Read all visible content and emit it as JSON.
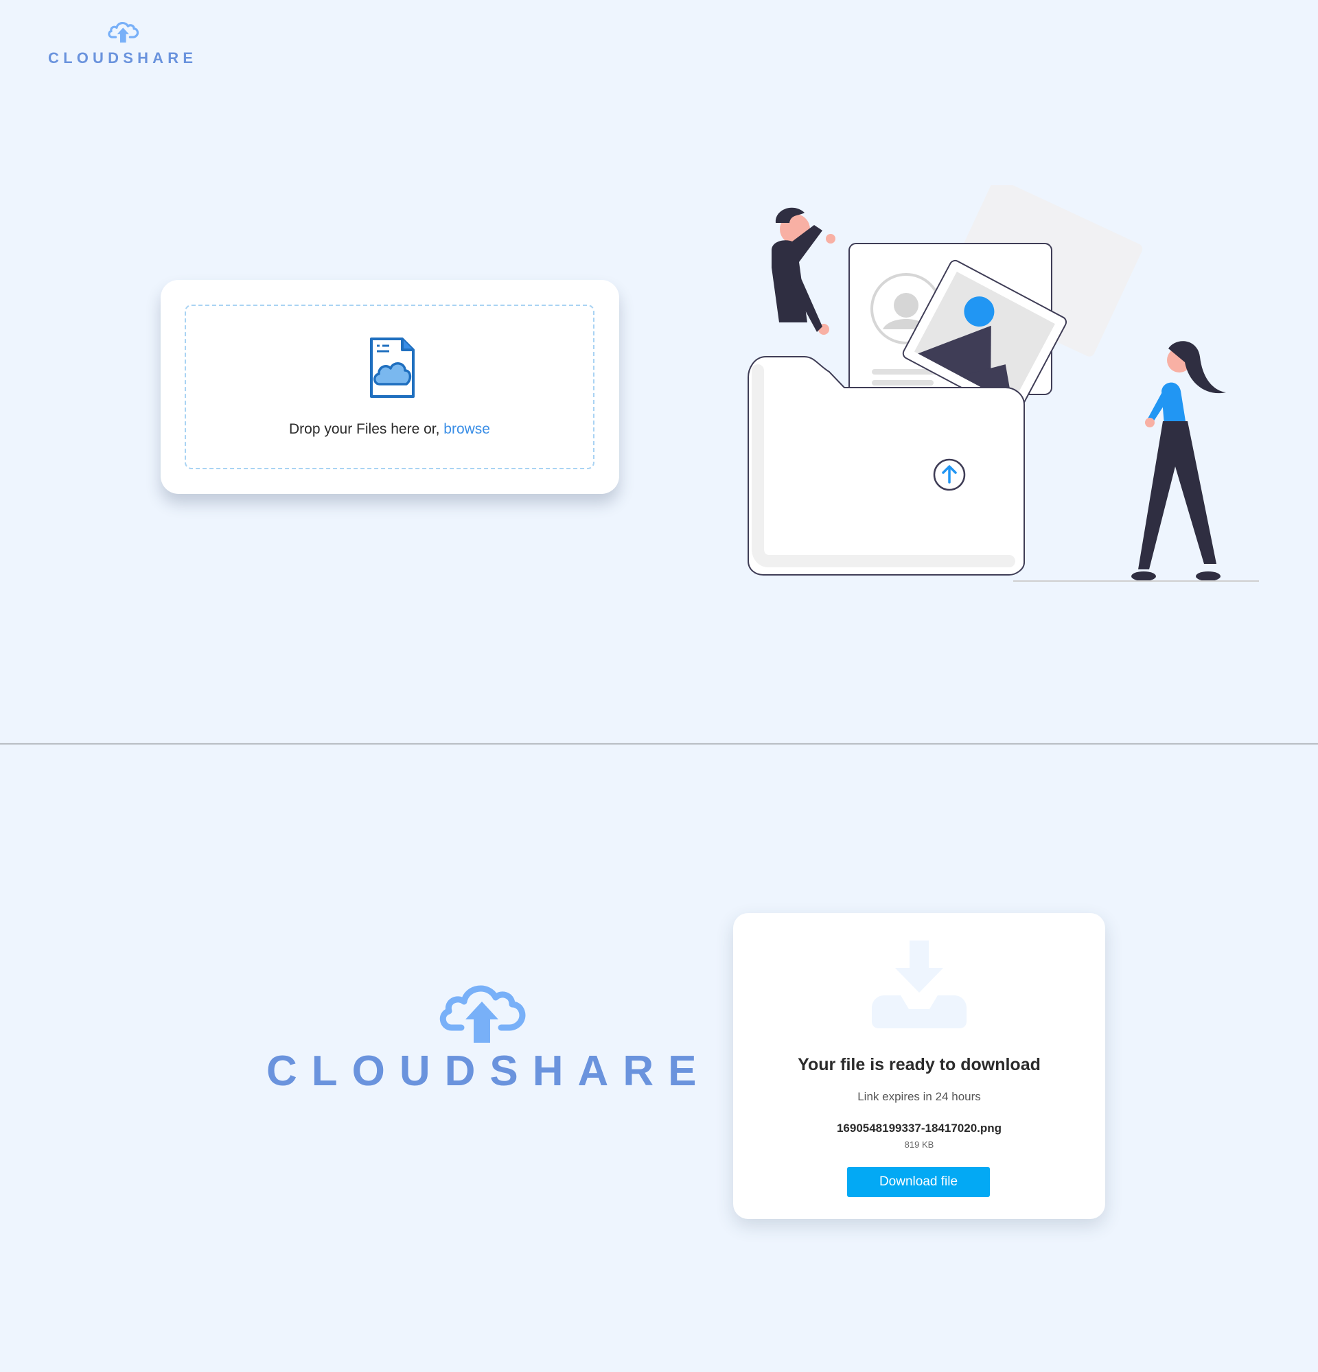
{
  "brand": {
    "name": "CLOUDSHARE",
    "logo_color": "#6a93dd",
    "cloud_color": "#78b0f8"
  },
  "upload": {
    "drop_text": "Drop your Files here or, ",
    "browse_label": "browse",
    "icon": "file-cloud-icon",
    "accent": "#3a8ee6"
  },
  "illustration": {
    "name": "people-uploading-files-illustration",
    "upload_icon": "arrow-up-circle-icon"
  },
  "download": {
    "icon": "inbox-download-icon",
    "title": "Your file is ready to download",
    "expiry": "Link expires in 24 hours",
    "filename": "1690548199337-18417020.png",
    "filesize": "819 KB",
    "button_label": "Download file",
    "button_color": "#03a9f4"
  }
}
